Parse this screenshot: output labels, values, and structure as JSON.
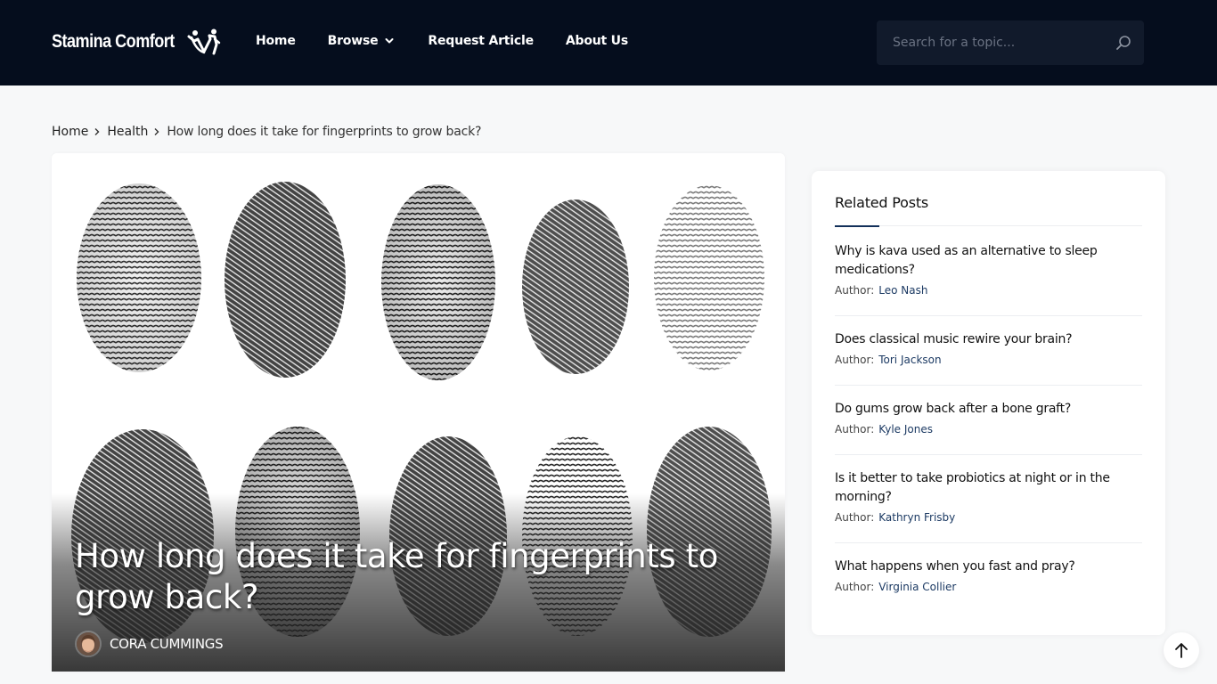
{
  "header": {
    "logo_text": "Stamina Comfort",
    "logo_icon": "people-heart-icon",
    "nav": [
      {
        "label": "Home"
      },
      {
        "label": "Browse",
        "has_dropdown": true
      },
      {
        "label": "Request Article"
      },
      {
        "label": "About Us"
      }
    ],
    "search": {
      "placeholder": "Search for a topic...",
      "value": "",
      "icon": "search-icon"
    }
  },
  "breadcrumb": {
    "items": [
      "Home",
      "Health"
    ],
    "current": "How long does it take for fingerprints to grow back?"
  },
  "article": {
    "title": "How long does it take for fingerprints to grow back?",
    "author": "CORA CUMMINGS",
    "hero_image_alt": "Ten black ink fingerprints on white background"
  },
  "sidebar": {
    "title": "Related Posts",
    "author_label": "Author:",
    "posts": [
      {
        "title": "Why is kava used as an alternative to sleep medications?",
        "author": "Leo Nash"
      },
      {
        "title": "Does classical music rewire your brain?",
        "author": "Tori Jackson"
      },
      {
        "title": "Do gums grow back after a bone graft?",
        "author": "Kyle Jones"
      },
      {
        "title": "Is it better to take probiotics at night or in the morning?",
        "author": "Kathryn Frisby"
      },
      {
        "title": "What happens when you fast and pray?",
        "author": "Virginia Collier"
      }
    ]
  },
  "back_to_top": {
    "icon": "arrow-up-icon"
  },
  "colors": {
    "header_bg": "#050d1d",
    "search_bg": "#111a2b",
    "accent": "#13305a",
    "author_link": "#1c3a63"
  }
}
